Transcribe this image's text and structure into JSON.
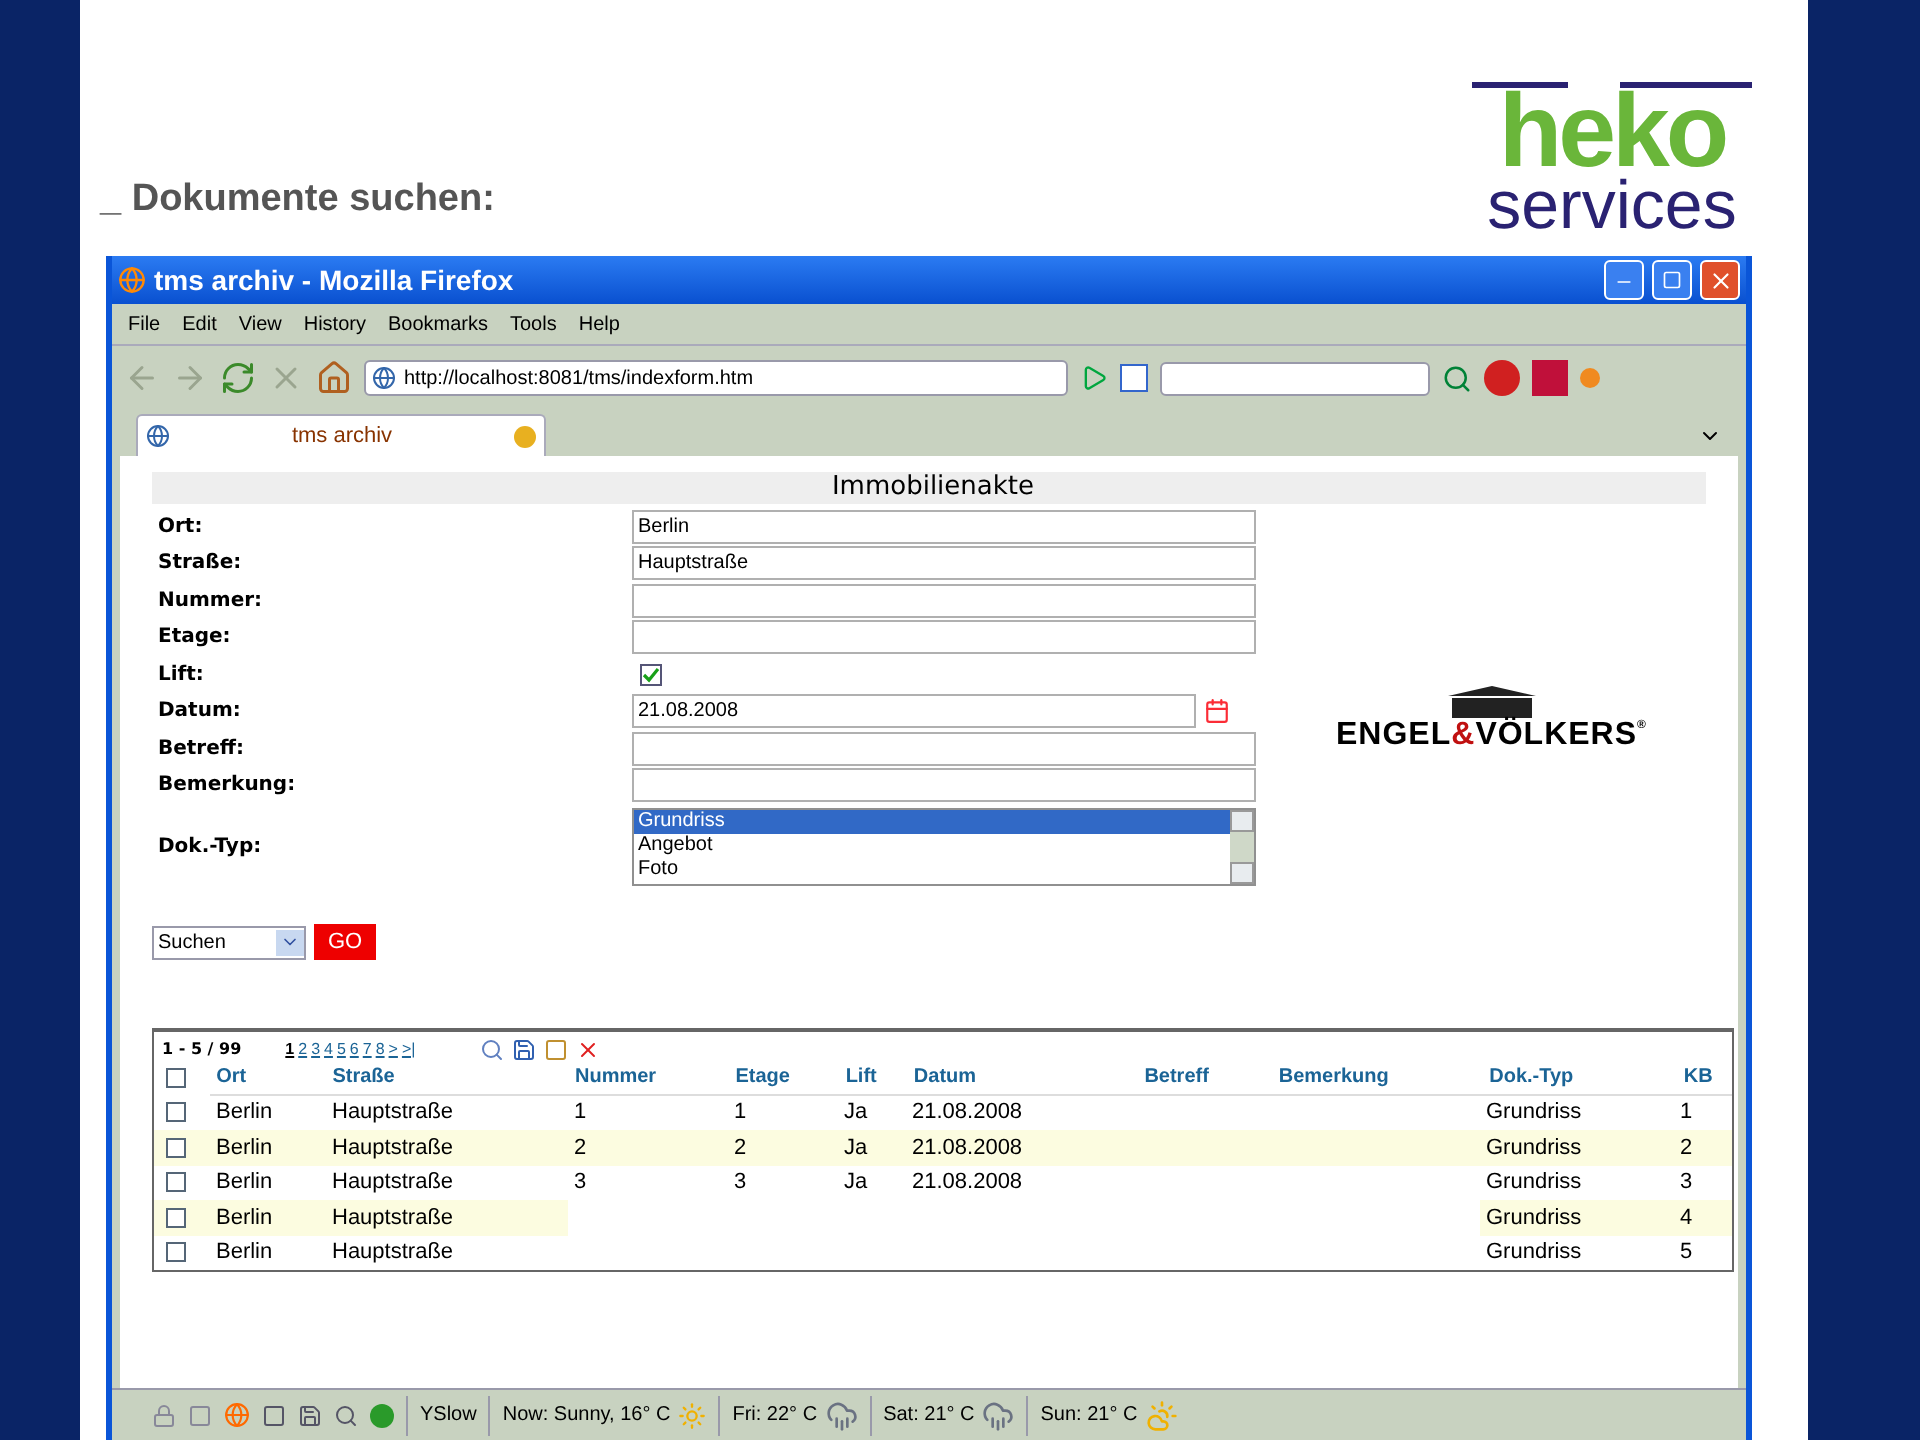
{
  "slide": {
    "heading": "_ Dokumente suchen:",
    "logo": {
      "top": "heko",
      "bottom": "services"
    }
  },
  "browser": {
    "title": "tms archiv - Mozilla Firefox",
    "menu": [
      "File",
      "Edit",
      "View",
      "History",
      "Bookmarks",
      "Tools",
      "Help"
    ],
    "url": "http://localhost:8081/tms/indexform.htm",
    "tab": "tms archiv",
    "status": [
      {
        "kind": "text",
        "text": "YSlow"
      },
      {
        "kind": "sunny",
        "text": "Now: Sunny, 16° C"
      },
      {
        "kind": "rain",
        "text": "Fri: 22° C"
      },
      {
        "kind": "rain",
        "text": "Sat: 21° C"
      },
      {
        "kind": "partly",
        "text": "Sun: 21° C"
      }
    ]
  },
  "form": {
    "title": "Immobilienakte",
    "fields": [
      {
        "label": "Ort:",
        "kind": "text",
        "value": "Berlin"
      },
      {
        "label": "Straße:",
        "kind": "text",
        "value": "Hauptstraße"
      },
      {
        "label": "Nummer:",
        "kind": "text"
      },
      {
        "label": "Etage:",
        "kind": "text"
      },
      {
        "label": "Lift:",
        "kind": "checkbox",
        "checked": true
      },
      {
        "label": "Datum:",
        "kind": "date",
        "value": "21.08.2008"
      },
      {
        "label": "Betreff:",
        "kind": "text"
      },
      {
        "label": "Bemerkung:",
        "kind": "text"
      },
      {
        "label": "Dok.-Typ:",
        "kind": "listbox",
        "options": [
          {
            "label": "Grundriss",
            "selected": true
          },
          {
            "label": "Angebot",
            "selected": false
          },
          {
            "label": "Foto",
            "selected": false
          }
        ]
      }
    ],
    "action_select": "Suchen",
    "go_button": "GO"
  },
  "brand": {
    "name_left": "ENGEL",
    "ampersand": "&",
    "name_right": "VÖLKERS",
    "mark": "®"
  },
  "table": {
    "range": "1 - 5 / 99",
    "select_all_checked": false,
    "pages": [
      {
        "label": "1",
        "selected": true
      },
      {
        "label": "2",
        "selected": false
      },
      {
        "label": "3",
        "selected": false
      },
      {
        "label": "4",
        "selected": false
      },
      {
        "label": "5",
        "selected": false
      },
      {
        "label": "6",
        "selected": false
      },
      {
        "label": "7",
        "selected": false
      },
      {
        "label": "8",
        "selected": false
      },
      {
        "label": ">",
        "selected": false
      },
      {
        "label": ">|",
        "selected": false
      }
    ],
    "columns": [
      "Ort",
      "Straße",
      "Nummer",
      "Etage",
      "Lift",
      "Datum",
      "Betreff",
      "Bemerkung",
      "Dok.-Typ",
      "KB"
    ],
    "rows": [
      {
        "checked": false,
        "cells": [
          "Berlin",
          "Hauptstraße",
          "1",
          "1",
          "Ja",
          "21.08.2008",
          "",
          "",
          "Grundriss",
          "1"
        ]
      },
      {
        "checked": false,
        "cells": [
          "Berlin",
          "Hauptstraße",
          "2",
          "2",
          "Ja",
          "21.08.2008",
          "",
          "",
          "Grundriss",
          "2"
        ]
      },
      {
        "checked": false,
        "cells": [
          "Berlin",
          "Hauptstraße",
          "3",
          "3",
          "Ja",
          "21.08.2008",
          "",
          "",
          "Grundriss",
          "3"
        ]
      },
      {
        "checked": false,
        "cells": [
          "Berlin",
          "Hauptstraße",
          "",
          "",
          "",
          "",
          "",
          "",
          "Grundriss",
          "4"
        ]
      },
      {
        "checked": false,
        "cells": [
          "Berlin",
          "Hauptstraße",
          "",
          "",
          "",
          "",
          "",
          "",
          "Grundriss",
          "5"
        ]
      }
    ]
  }
}
